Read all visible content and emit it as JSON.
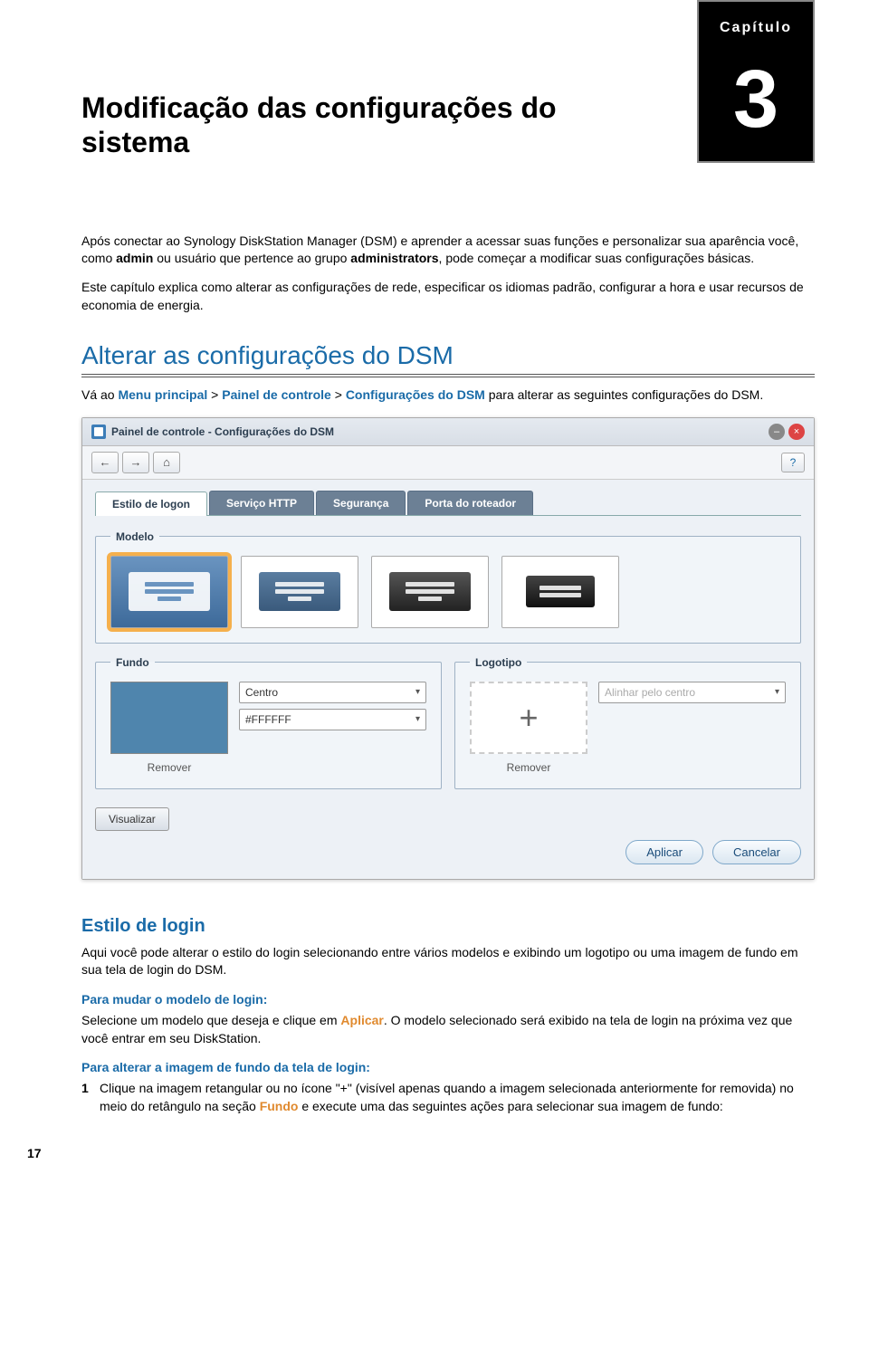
{
  "chapter": {
    "label": "Capítulo",
    "number": "3"
  },
  "title": "Modificação das configurações do sistema",
  "intro": {
    "p1_a": "Após conectar ao Synology DiskStation Manager (DSM) e aprender a acessar suas funções e personalizar sua aparência você, como ",
    "p1_bold1": "admin",
    "p1_b": " ou usuário que pertence ao grupo ",
    "p1_bold2": "administrators",
    "p1_c": ", pode começar a modificar suas configurações básicas.",
    "p2": "Este capítulo explica como alterar as configurações de rede, especificar os idiomas padrão, configurar a hora e usar recursos de economia de energia."
  },
  "section": {
    "heading": "Alterar as configurações do DSM",
    "lead_a": "Vá ao ",
    "nav1": "Menu principal",
    "sep1": " > ",
    "nav2": "Painel de controle",
    "sep2": " > ",
    "nav3": "Configurações do DSM",
    "lead_b": " para alterar as seguintes configurações do DSM."
  },
  "panel": {
    "title": "Painel de controle - Configurações do DSM",
    "help": "?",
    "nav_back": "←",
    "nav_fwd": "→",
    "nav_home": "⌂",
    "ctrl_min": "–",
    "ctrl_close": "×",
    "tabs": [
      "Estilo de logon",
      "Serviço HTTP",
      "Segurança",
      "Porta do roteador"
    ],
    "modelo_legend": "Modelo",
    "fundo_legend": "Fundo",
    "logotipo_legend": "Logotipo",
    "fundo_position": "Centro",
    "fundo_color": "#FFFFFF",
    "remover": "Remover",
    "logo_plus": "+",
    "logo_align": "Alinhar pelo centro",
    "visualizar": "Visualizar",
    "aplicar": "Aplicar",
    "cancelar": "Cancelar"
  },
  "login": {
    "heading": "Estilo de login",
    "p1": "Aqui você pode alterar o estilo do login selecionando entre vários modelos e exibindo um logotipo ou uma imagem de fundo em sua tela de login do DSM.",
    "h1": "Para mudar o modelo de login:",
    "h1p_a": "Selecione um modelo que deseja e clique em ",
    "h1p_accent": "Aplicar",
    "h1p_b": ". O modelo selecionado será exibido na tela de login na próxima vez que você entrar em seu DiskStation.",
    "h2": "Para alterar a imagem de fundo da tela de login:",
    "h2li_a": "Clique na imagem retangular ou no ícone \"+\" (visível apenas quando a imagem selecionada anteriormente for removida) no meio do retângulo na seção ",
    "h2li_accent": "Fundo",
    "h2li_b": " e execute uma das seguintes ações para selecionar sua imagem de fundo:"
  },
  "page_number": "17"
}
